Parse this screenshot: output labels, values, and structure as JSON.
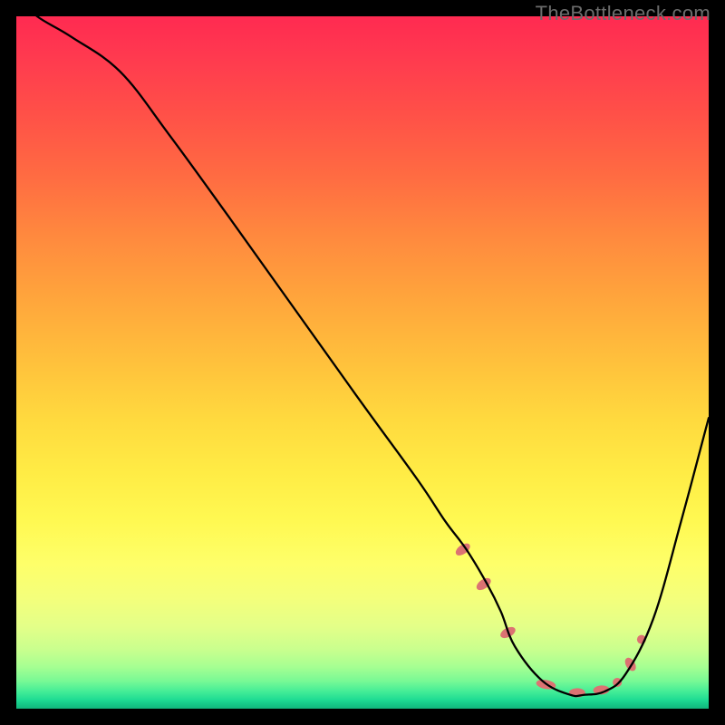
{
  "watermark": "TheBottleneck.com",
  "chart_data": {
    "type": "line",
    "title": "",
    "xlabel": "",
    "ylabel": "",
    "xlim": [
      0,
      100
    ],
    "ylim": [
      0,
      100
    ],
    "series": [
      {
        "name": "bottleneck-curve",
        "x": [
          0,
          3,
          8,
          15,
          22,
          30,
          40,
          50,
          58,
          62,
          65,
          68,
          70,
          72,
          76,
          80,
          82,
          85,
          88,
          92,
          96,
          100
        ],
        "values": [
          103,
          100,
          97,
          92,
          83,
          72,
          58,
          44,
          33,
          27,
          23,
          18,
          14,
          9,
          4,
          2,
          2,
          2.5,
          5,
          13,
          27,
          42
        ],
        "color": "#000000",
        "width": 2.3
      }
    ],
    "markers": {
      "name": "highlighted-points",
      "color": "#dc7272",
      "points": [
        {
          "x": 64.5,
          "y": 23,
          "rx": 5,
          "ry": 9,
          "rot": 55
        },
        {
          "x": 67.5,
          "y": 18,
          "rx": 5,
          "ry": 9,
          "rot": 55
        },
        {
          "x": 71,
          "y": 11,
          "rx": 5,
          "ry": 9,
          "rot": 62
        },
        {
          "x": 76.5,
          "y": 3.5,
          "rx": 11,
          "ry": 5,
          "rot": 10
        },
        {
          "x": 81,
          "y": 2.3,
          "rx": 9,
          "ry": 5,
          "rot": 0
        },
        {
          "x": 84.5,
          "y": 2.7,
          "rx": 9,
          "ry": 5,
          "rot": -4
        },
        {
          "x": 86.8,
          "y": 3.8,
          "rx": 5,
          "ry": 5,
          "rot": 0
        },
        {
          "x": 88.7,
          "y": 6.4,
          "rx": 5,
          "ry": 8,
          "rot": -32
        },
        {
          "x": 90.3,
          "y": 10,
          "rx": 5,
          "ry": 5,
          "rot": 0
        }
      ]
    }
  }
}
